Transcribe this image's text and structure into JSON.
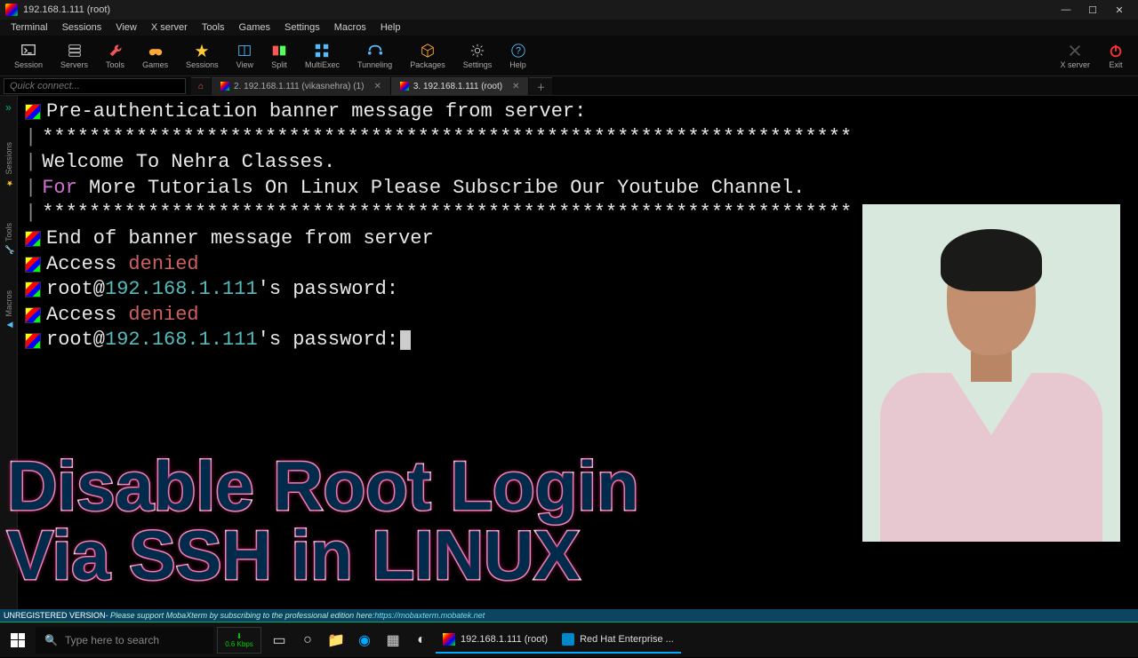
{
  "window": {
    "title": "192.168.1.111 (root)"
  },
  "menu": [
    "Terminal",
    "Sessions",
    "View",
    "X server",
    "Tools",
    "Games",
    "Settings",
    "Macros",
    "Help"
  ],
  "toolbar": [
    {
      "id": "session",
      "label": "Session"
    },
    {
      "id": "servers",
      "label": "Servers"
    },
    {
      "id": "tools",
      "label": "Tools"
    },
    {
      "id": "games",
      "label": "Games"
    },
    {
      "id": "sessions",
      "label": "Sessions"
    },
    {
      "id": "view",
      "label": "View"
    },
    {
      "id": "split",
      "label": "Split"
    },
    {
      "id": "multiexec",
      "label": "MultiExec"
    },
    {
      "id": "tunneling",
      "label": "Tunneling"
    },
    {
      "id": "packages",
      "label": "Packages"
    },
    {
      "id": "settings",
      "label": "Settings"
    },
    {
      "id": "help",
      "label": "Help"
    }
  ],
  "toolbar_right": [
    {
      "id": "xserver",
      "label": "X server"
    },
    {
      "id": "exit",
      "label": "Exit"
    }
  ],
  "quickconnect": {
    "placeholder": "Quick connect..."
  },
  "tabs": [
    {
      "id": "tab1",
      "label": "2. 192.168.1.111 (vikasnehra) (1)",
      "active": false
    },
    {
      "id": "tab2",
      "label": "3. 192.168.1.111 (root)",
      "active": true
    }
  ],
  "sidetabs": [
    "Sessions",
    "Tools",
    "Macros"
  ],
  "terminal": {
    "banner_head": "Pre-authentication banner message from server:",
    "stars": "*********************************************************************",
    "welcome": "Welcome To Nehra Classes.",
    "for": "For",
    "subscribe": " More Tutorials On Linux Please Subscribe Our Youtube Channel.",
    "end": "End of banner message from server",
    "access": "Access ",
    "denied": "denied",
    "root": "root@",
    "ip": "192.168.1.111",
    "pwd": "'s password:"
  },
  "overlay": {
    "line1": "Disable Root Login",
    "line2": "Via SSH in LINUX"
  },
  "statusbar": {
    "unreg": "UNREGISTERED VERSION",
    "msg": " - Please support MobaXterm by subscribing to the professional edition here: ",
    "link": "https://mobaxterm.mobatek.net"
  },
  "taskbar": {
    "search": "Type here to search",
    "net": "0.6 Kbps",
    "items": [
      {
        "id": "moba",
        "label": "192.168.1.111 (root)",
        "color": "#3a3"
      },
      {
        "id": "rhel",
        "label": "Red Hat Enterprise ...",
        "color": "#e33"
      }
    ]
  }
}
